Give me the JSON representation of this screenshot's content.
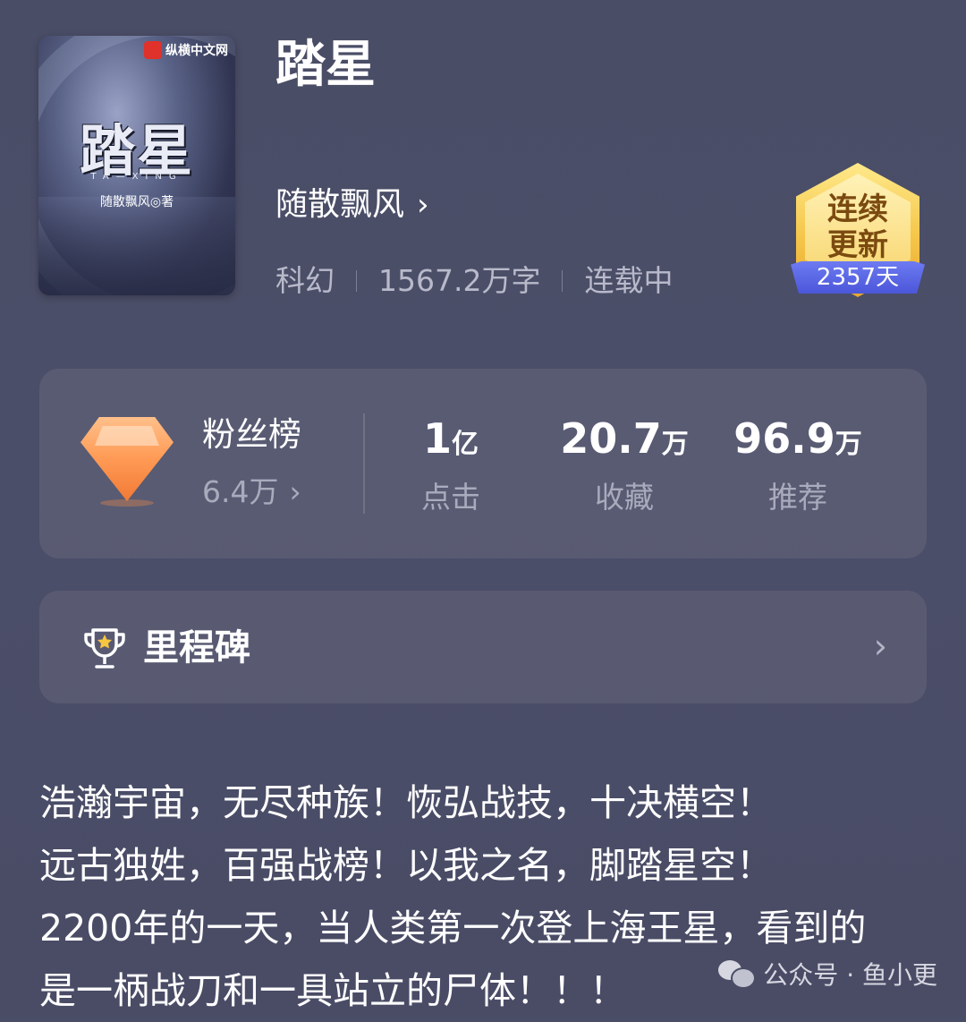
{
  "book": {
    "cover": {
      "publisher": "纵横中文网",
      "title": "踏星",
      "pinyin": "TA—XING",
      "author_line": "随散飘风◎著"
    },
    "title": "踏星",
    "author": "随散飘风",
    "author_chevron": "›",
    "genre": "科幻",
    "word_count": "1567.2万字",
    "status": "连载中"
  },
  "badge": {
    "text_line1": "连续",
    "text_line2": "更新",
    "days": "2357天",
    "colors": {
      "gold": "#f5c64a",
      "ribbon": "#4b57d9"
    }
  },
  "stats": {
    "fans_label": "粉丝榜",
    "fans_value": "6.4万",
    "fans_chevron": "›",
    "items": [
      {
        "num": "1",
        "unit": "亿",
        "label": "点击"
      },
      {
        "num": "20.7",
        "unit": "万",
        "label": "收藏"
      },
      {
        "num": "96.9",
        "unit": "万",
        "label": "推荐"
      }
    ]
  },
  "milestone": {
    "label": "里程碑",
    "chevron": "›"
  },
  "synopsis": {
    "lines": [
      "浩瀚宇宙，无尽种族！恢弘战技，十决横空！",
      "远古独姓，百强战榜！以我之名，脚踏星空！",
      "2200年的一天，当人类第一次登上海王星，看到的",
      "是一柄战刀和一具站立的尸体！！！"
    ]
  },
  "watermark": {
    "text": "公众号 · 鱼小更"
  },
  "icons": {
    "gem": "diamond-icon",
    "trophy": "trophy-icon",
    "wechat": "wechat-icon"
  }
}
